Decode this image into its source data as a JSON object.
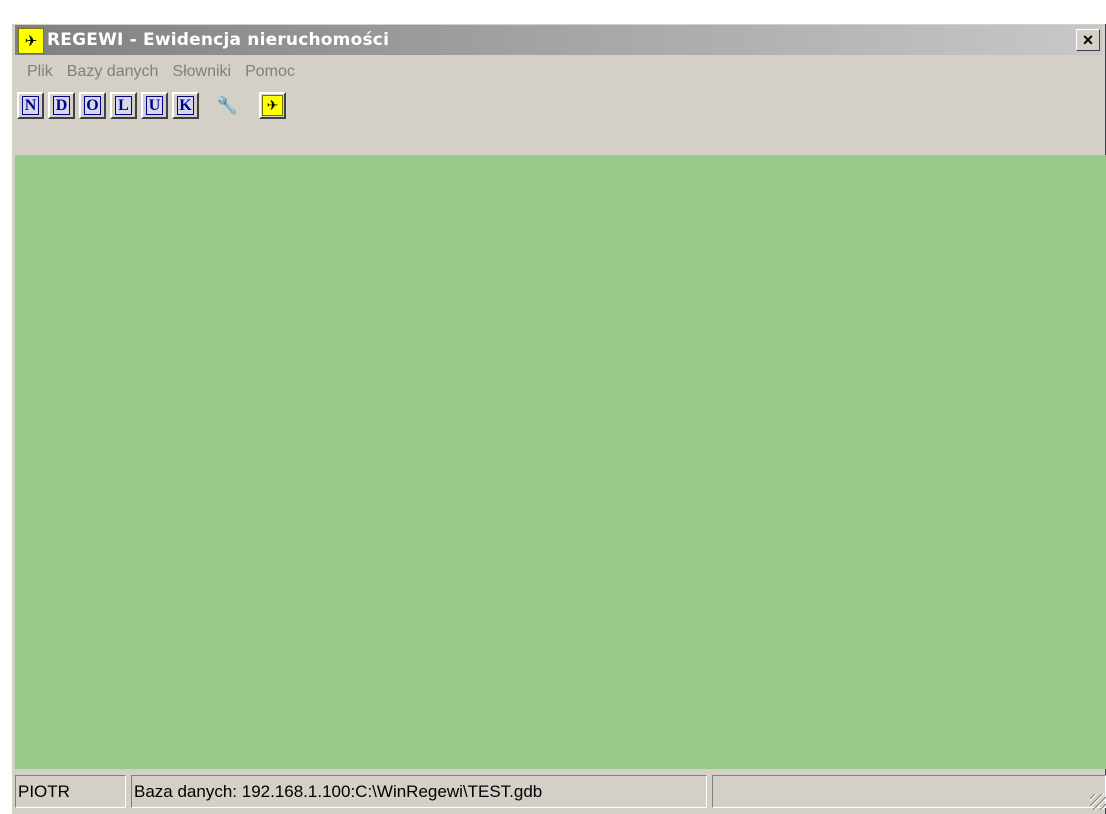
{
  "window": {
    "title": "REGEWI - Ewidencja nieruchomości",
    "app_icon": "regewi-running-figure-icon",
    "close_label": "×"
  },
  "menu": [
    "Plik",
    "Bazy danych",
    "Słowniki",
    "Pomoc"
  ],
  "toolbar": {
    "letter_buttons": [
      "N",
      "D",
      "O",
      "L",
      "U",
      "K"
    ],
    "extra_buttons": [
      {
        "name": "tools-icon",
        "glyph": "🔧"
      },
      {
        "name": "regewi-runner-icon",
        "glyph": "✈"
      }
    ]
  },
  "colors": {
    "workspace": "#99c988",
    "titlebar_inactive": "#808080",
    "face": "#d4d0c8"
  },
  "status": {
    "user": "PIOTR",
    "database": "Baza danych: 192.168.1.100:C:\\WinRegewi\\TEST.gdb",
    "panel3": ""
  }
}
